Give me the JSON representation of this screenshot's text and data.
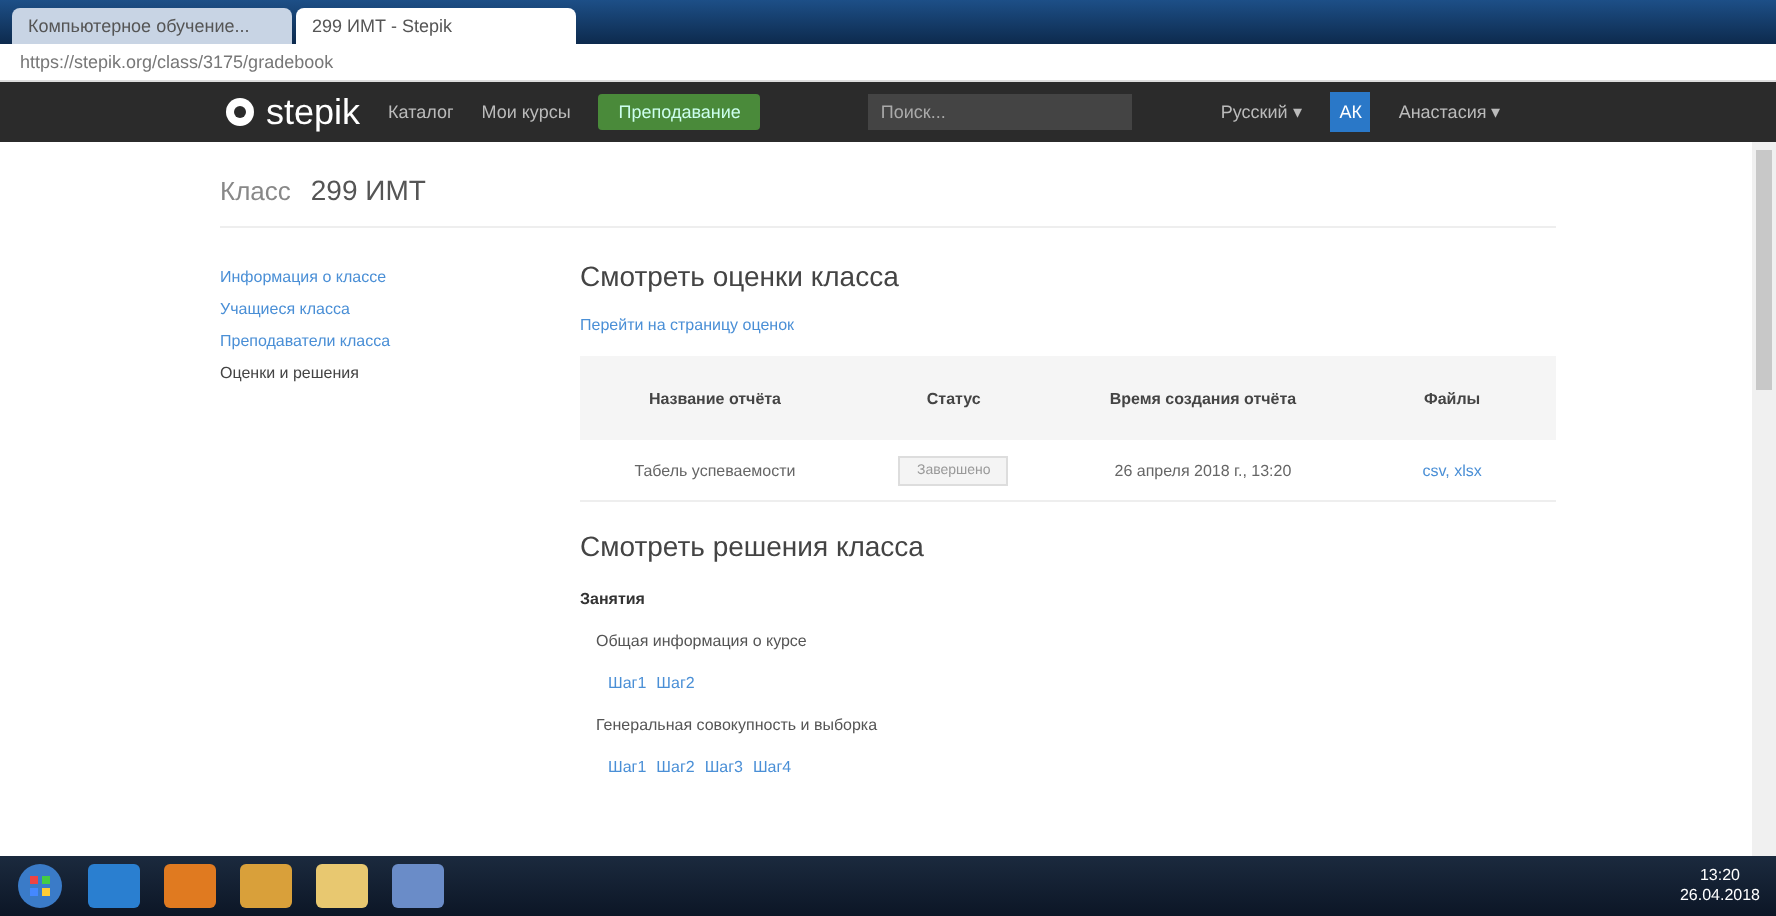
{
  "browser": {
    "tabs": [
      {
        "title": "Компьютерное обучение...",
        "selected": false
      },
      {
        "title": "299 ИМТ - Stepik",
        "selected": true
      }
    ],
    "url": "https://stepik.org/class/3175/gradebook"
  },
  "nav": {
    "logo": "stepik",
    "links": [
      "Каталог",
      "Мои курсы"
    ],
    "teach_button": "Преподавание",
    "search": {
      "placeholder": "Поиск..."
    },
    "language": "Русский ▾",
    "avatar": "АК",
    "user": "Анастасия ▾"
  },
  "header": {
    "label": "Класс",
    "name": "299 ИМТ"
  },
  "sidebar": {
    "items": [
      {
        "label": "Информация о классе",
        "selected": false
      },
      {
        "label": "Учащиеся класса",
        "selected": false
      },
      {
        "label": "Преподаватели класса",
        "selected": false
      },
      {
        "label": "Оценки и решения",
        "selected": true
      }
    ]
  },
  "grades": {
    "title": "Смотреть оценки класса",
    "link": "Перейти на страницу оценок",
    "columns": [
      "Название отчёта",
      "Статус",
      "Время создания отчёта",
      "Файлы"
    ],
    "rows": [
      {
        "name": "Табель успеваемости",
        "status": "Завершено",
        "created": "26 апреля 2018 г., 13:20",
        "files": "csv, xlsx"
      }
    ]
  },
  "solutions": {
    "title": "Смотреть решения класса",
    "section": "Занятия",
    "lessons": [
      {
        "title": "Общая информация о курсе",
        "steps": [
          "Шаг1",
          "Шаг2"
        ]
      },
      {
        "title": "Генеральная совокупность и выборка",
        "steps": [
          "Шаг1",
          "Шаг2",
          "Шаг3",
          "Шаг4"
        ]
      }
    ]
  },
  "taskbar": {
    "time": "13:20",
    "date": "26.04.2018"
  }
}
